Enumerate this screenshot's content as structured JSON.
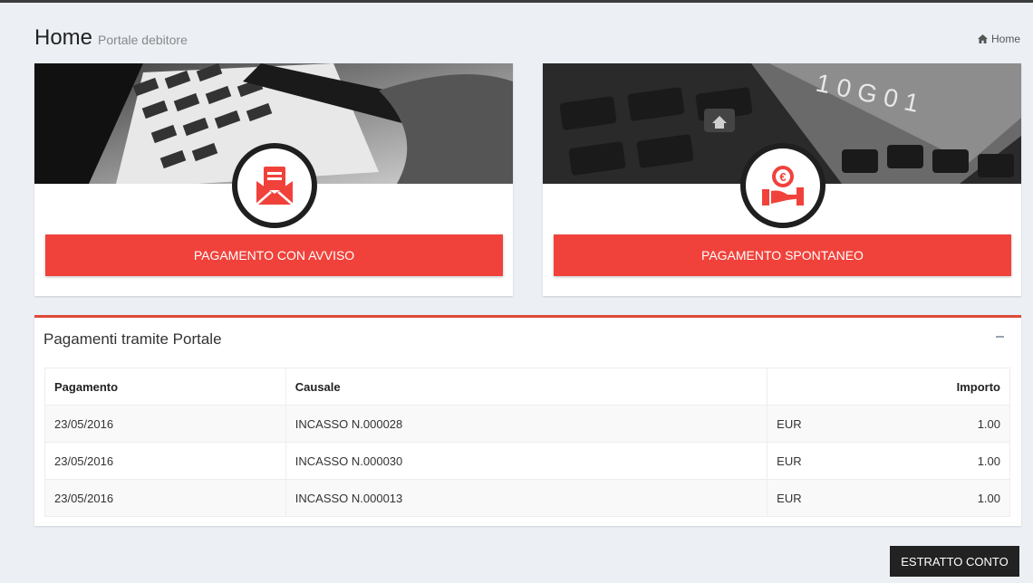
{
  "header": {
    "title": "Home",
    "subtitle": "Portale debitore",
    "breadcrumb": "Home"
  },
  "cards": [
    {
      "button_label": "PAGAMENTO CON AVVISO",
      "icon": "envelope-document-icon"
    },
    {
      "button_label": "PAGAMENTO SPONTANEO",
      "icon": "euro-hand-icon"
    }
  ],
  "payments_box": {
    "title": "Pagamenti tramite Portale",
    "columns": [
      "Pagamento",
      "Causale",
      "Importo"
    ],
    "rows": [
      {
        "date": "23/05/2016",
        "causale": "INCASSO N.000028",
        "currency": "EUR",
        "amount": "1.00"
      },
      {
        "date": "23/05/2016",
        "causale": "INCASSO N.000030",
        "currency": "EUR",
        "amount": "1.00"
      },
      {
        "date": "23/05/2016",
        "causale": "INCASSO N.000013",
        "currency": "EUR",
        "amount": "1.00"
      }
    ]
  },
  "footer": {
    "estratto_label": "ESTRATTO CONTO"
  },
  "colors": {
    "accent_red": "#f0423b",
    "box_border": "#dd4b39",
    "background": "#ecf0f5",
    "dark_button": "#222222"
  }
}
